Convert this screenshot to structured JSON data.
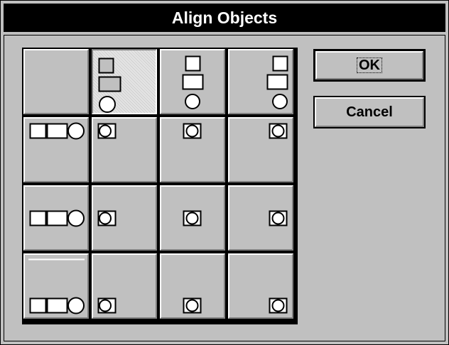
{
  "dialog": {
    "title": "Align Objects"
  },
  "buttons": {
    "ok_label": "OK",
    "cancel_label": "Cancel"
  },
  "grid": {
    "selected": "top-left",
    "vertical_alignment_rows": [
      "none",
      "top",
      "center",
      "bottom"
    ],
    "horizontal_alignment_columns": [
      "none",
      "left",
      "center",
      "right"
    ]
  }
}
